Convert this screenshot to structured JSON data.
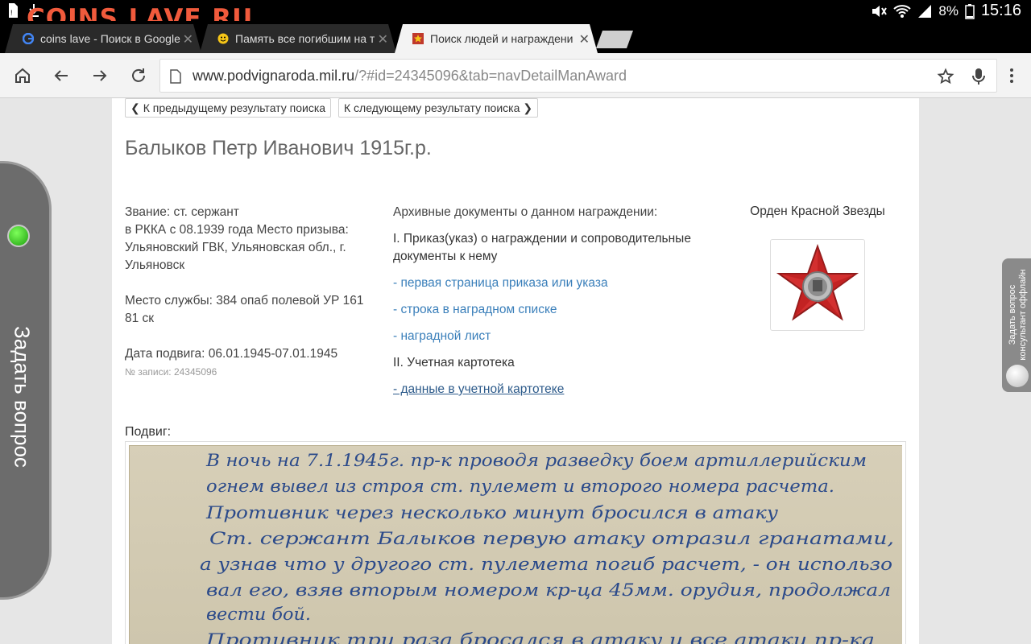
{
  "watermark": "COINS.LAVE.RU",
  "status": {
    "battery": "8%",
    "time": "15:16"
  },
  "tabs": [
    {
      "label": "coins lave - Поиск в Google",
      "favicon": "google-icon"
    },
    {
      "label": "Память все погибшим на т",
      "favicon": "smiley-icon"
    },
    {
      "label": "Поиск людей и награждени",
      "favicon": "star-icon"
    }
  ],
  "url": {
    "domain": "www.podvignaroda.mil.ru",
    "path": "/?#id=24345096&tab=navDetailManAward"
  },
  "nav": {
    "prev": "К предыдущему результату поиска",
    "next": "К следующему результату поиска"
  },
  "person": {
    "name": "Балыков Петр Иванович 1915г.р.",
    "rank_lines": [
      "Звание: ст. сержант",
      "в РККА с 08.1939 года Место призыва:",
      "Ульяновский ГВК, Ульяновская обл., г.",
      "Ульяновск"
    ],
    "service_lines": [
      "Место службы: 384 опаб полевой УР 161",
      "81 ск"
    ],
    "feat_date": "Дата подвига: 06.01.1945-07.01.1945",
    "record_no": "№ записи: 24345096"
  },
  "archive": {
    "heading": "Архивные документы о данном награждении:",
    "section1": [
      "I. Приказ(указ) о награждении и сопроводительные",
      "документы к нему"
    ],
    "links": [
      "- первая страница приказа или указа",
      "- строка в наградном списке",
      "- наградной лист"
    ],
    "section2": "II. Учетная картотека",
    "card_link": "- данные в учетной картотеке"
  },
  "award": {
    "title": "Орден Красной Звезды"
  },
  "podvig_label": "Подвиг:",
  "handwriting": [
    "В ночь на 7.1.1945г. пр-к проводя разведку боем артиллерийским",
    "огнем вывел из строя ст. пулемет и второго номера расчета.",
    "Противник через несколько минут бросился в атаку",
    "Ст. сержант Балыков первую атаку отразил гранатами,",
    "а узнав что у другого ст. пулемета погиб расчет, - он использо",
    "вал его, взяв вторым номером кр-ца 45мм. орудия, продолжал",
    "вести бой.",
    "Противник три раза бросался в атаку и все атаки пр-ка"
  ],
  "side": {
    "ask": "Задать вопрос",
    "consult_lines": [
      "Задать вопрос",
      "консультант оффлайн"
    ]
  },
  "colors": {
    "link": "#3a7fba",
    "ask_widget": "#6c6c6c",
    "ink": "#2b4a8a"
  }
}
